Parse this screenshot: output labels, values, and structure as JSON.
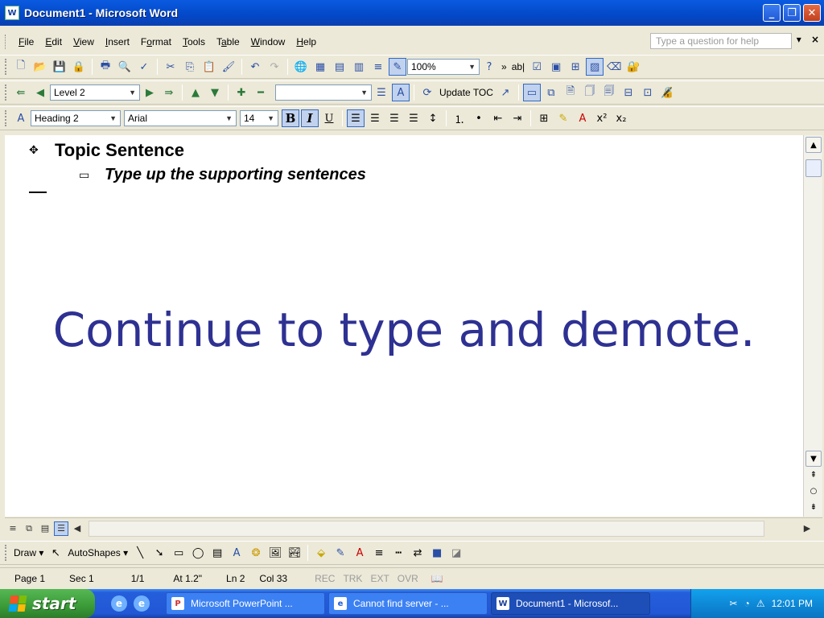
{
  "window": {
    "title": "Document1 - Microsoft Word",
    "app_icon": "W",
    "min": "_",
    "max": "❐",
    "close": "✕"
  },
  "menubar": {
    "items": [
      {
        "pre": "",
        "u": "F",
        "post": "ile"
      },
      {
        "pre": "",
        "u": "E",
        "post": "dit"
      },
      {
        "pre": "",
        "u": "V",
        "post": "iew"
      },
      {
        "pre": "",
        "u": "I",
        "post": "nsert"
      },
      {
        "pre": "F",
        "u": "o",
        "post": "rmat"
      },
      {
        "pre": "",
        "u": "T",
        "post": "ools"
      },
      {
        "pre": "T",
        "u": "a",
        "post": "ble"
      },
      {
        "pre": "",
        "u": "W",
        "post": "indow"
      },
      {
        "pre": "",
        "u": "H",
        "post": "elp"
      }
    ],
    "help_placeholder": "Type a question for help",
    "help_arrow": "▾",
    "close_doc": "×"
  },
  "standard_toolbar": {
    "zoom": "100%",
    "chevron": "»",
    "text_field": "ab|"
  },
  "outlining_toolbar": {
    "level": "Level 2",
    "update_toc": "Update TOC"
  },
  "formatting_toolbar": {
    "style": "Heading 2",
    "font": "Arial",
    "size": "14",
    "bold": "B",
    "italic": "I",
    "underline": "U"
  },
  "document": {
    "level1_text": "Topic Sentence",
    "level2_text": "Type up the supporting sentences",
    "level1_symbol": "✥",
    "level2_symbol": "▭"
  },
  "overlay_text": "Continue to type and demote.",
  "drawing_toolbar": {
    "draw": "Draw ▾",
    "autoshapes": "AutoShapes ▾"
  },
  "status": {
    "page": "Page 1",
    "sec": "Sec 1",
    "pages": "1/1",
    "at": "At 1.2\"",
    "ln": "Ln 2",
    "col": "Col 33",
    "rec": "REC",
    "trk": "TRK",
    "ext": "EXT",
    "ovr": "OVR"
  },
  "taskbar": {
    "start": "start",
    "tasks": [
      "Microsoft PowerPoint ...",
      "Cannot find server - ...",
      "Document1 - Microsof..."
    ],
    "clock": "12:01 PM"
  },
  "colors": {
    "titlebar": "#0348C8",
    "overlay_text": "#2e3192",
    "taskbar": "#2257d5",
    "start": "#3a9a37"
  }
}
